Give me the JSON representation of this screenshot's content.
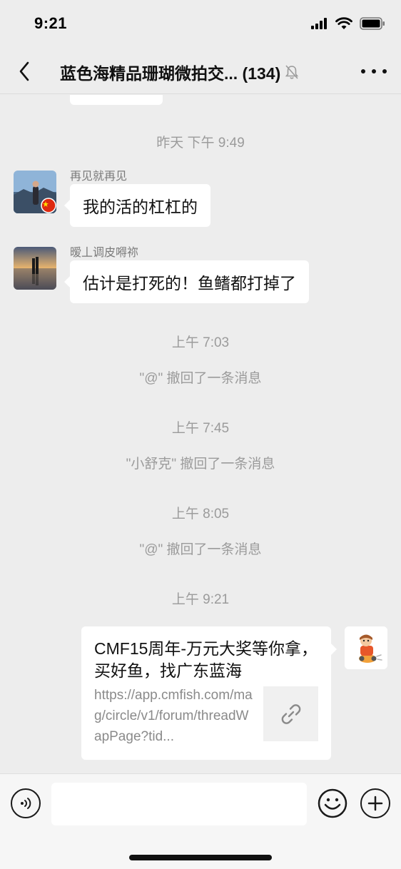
{
  "status_bar": {
    "time": "9:21",
    "icons": [
      "cellular-signal-icon",
      "wifi-icon",
      "battery-icon"
    ]
  },
  "nav": {
    "back_icon": "chevron-left-icon",
    "title": "蓝色海精品珊瑚微拍交... (134)",
    "mute_icon": "bell-slash-icon",
    "more_icon": "ellipsis-icon"
  },
  "messages": [
    {
      "type": "timestamp",
      "text": "昨天 下午 9:49"
    },
    {
      "type": "incoming",
      "sender": "再见就再见",
      "text": "我的活的杠杠的",
      "avatar_icon": "user-avatar-icon",
      "badge_icon": "flag-badge-icon"
    },
    {
      "type": "incoming",
      "sender": "暧丄调皮嘚祢",
      "text": "估计是打死的！鱼鳍都打掉了",
      "avatar_icon": "user-avatar-icon"
    },
    {
      "type": "timestamp",
      "text": "上午 7:03"
    },
    {
      "type": "system",
      "text": "\"@\" 撤回了一条消息"
    },
    {
      "type": "timestamp",
      "text": "上午 7:45"
    },
    {
      "type": "system",
      "text": "\"小舒克\" 撤回了一条消息"
    },
    {
      "type": "timestamp",
      "text": "上午 8:05"
    },
    {
      "type": "system",
      "text": "\"@\" 撤回了一条消息"
    },
    {
      "type": "timestamp",
      "text": "上午 9:21"
    },
    {
      "type": "outgoing-link",
      "title": "CMF15周年-万元大奖等你拿，买好鱼，找广东蓝海",
      "description": "https://app.cmfish.com/mag/circle/v1/forum/threadWapPage?tid...",
      "thumb_icon": "link-icon",
      "avatar_icon": "cartoon-avatar-icon"
    }
  ],
  "input_bar": {
    "voice_icon": "voice-icon",
    "placeholder": "",
    "emoji_icon": "smiley-icon",
    "plus_icon": "plus-icon"
  },
  "colors": {
    "background": "#ededed",
    "bubble": "#ffffff",
    "meta_text": "#9b9b9b"
  }
}
